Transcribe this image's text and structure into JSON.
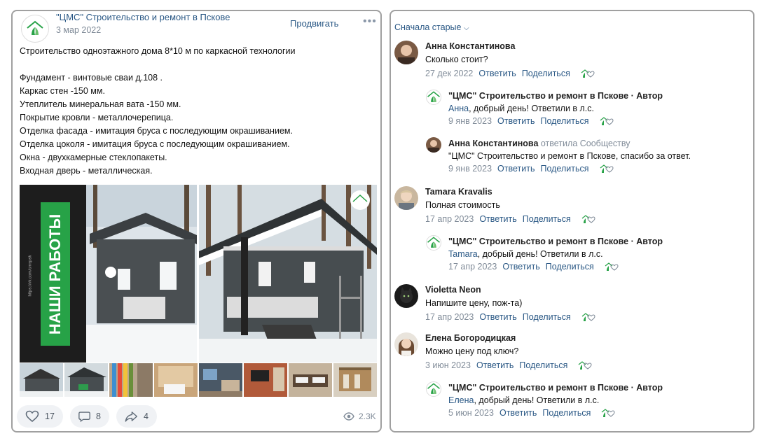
{
  "post": {
    "author": "\"ЦМС\" Строительство и ремонт в Пскове",
    "date": "3 мар 2022",
    "promote_label": "Продвигать",
    "more_label": "•••",
    "text": "Строительство одноэтажного дома 8*10 м по каркасной технологии\n\nФундамент - винтовые сваи д.108 .\nКаркас стен -150 мм.\nУтеплитель минеральная вата -150 мм.\nПокрытие кровли - металлочерепица.\nОтделка фасада - имитация бруса с последующим окрашиванием.\nОтделка цоколя - имитация бруса с последующим окрашиванием.\nОкна - двухкамерные стеклопакеты.\nВходная дверь - металлическая.",
    "banner_text": "НАШИ РАБОТЫ",
    "banner_url": "https://vk.com/cmspsk",
    "likes": "17",
    "comments": "8",
    "shares": "4",
    "views": "2.3K"
  },
  "colors": {
    "link": "#2a5885",
    "muted": "#818c99",
    "brand_green": "#27a247",
    "action_bg": "#f0f2f5"
  },
  "comments": {
    "sort_label": "Сначала старые",
    "reply_label": "Ответить",
    "share_label": "Поделиться",
    "items": [
      {
        "name": "Анна Константинова",
        "text": "Сколько стоит?",
        "date": "27 дек 2022"
      },
      {
        "name": "\"ЦМС\" Строительство и ремонт в Пскове · Автор",
        "mention": "Анна",
        "text": ", добрый день! Ответили в л.с.",
        "date": "9 янв 2023"
      },
      {
        "name": "Анна Константинова",
        "name_suffix": " ответила Сообществу",
        "text": "\"ЦМС\" Строительство и ремонт в Пскове, спасибо за ответ.",
        "date": "9 янв 2023"
      },
      {
        "name": "Tamara Kravalis",
        "text": "Полная стоимость",
        "date": "17 апр 2023"
      },
      {
        "name": "\"ЦМС\" Строительство и ремонт в Пскове · Автор",
        "mention": "Tamara",
        "text": ", добрый день! Ответили в л.с.",
        "date": "17 апр 2023"
      },
      {
        "name": "Violetta Neon",
        "text": "Напишите цену, пож-та)",
        "date": "17 апр 2023"
      },
      {
        "name": "Елена Богородицкая",
        "text": "Можно цену под ключ?",
        "date": "3 июн 2023"
      },
      {
        "name": "\"ЦМС\" Строительство и ремонт в Пскове · Автор",
        "mention": "Елена",
        "text": ", добрый день! Ответили в л.с.",
        "date": "5 июн 2023"
      }
    ]
  }
}
